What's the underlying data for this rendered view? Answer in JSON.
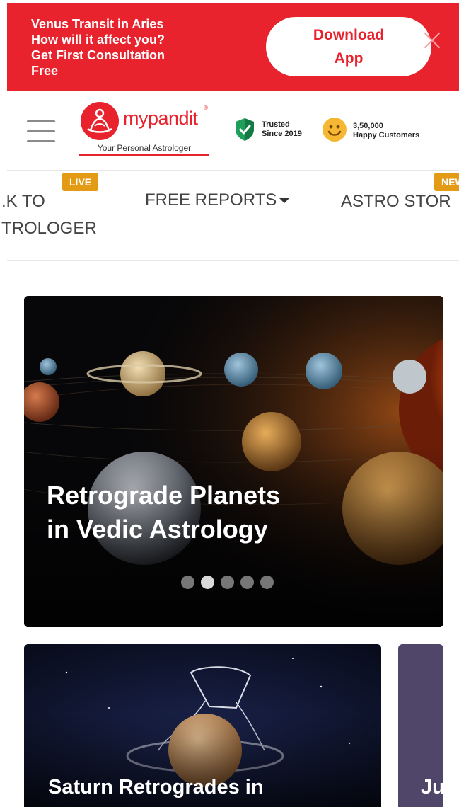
{
  "promo": {
    "lines": [
      "Venus Transit in Aries",
      "How will it affect you?",
      "Get First Consultation",
      "Free"
    ],
    "download_lines": [
      "Download",
      "App"
    ],
    "close_icon": "close-icon"
  },
  "header": {
    "menu_icon": "hamburger-icon",
    "logo_word": "mypandit",
    "logo_tm": "®",
    "logo_tagline": "Your Personal Astrologer",
    "trust_lines": [
      "Trusted",
      "Since 2019"
    ],
    "happy_lines": [
      "3,50,000",
      "Happy Customers"
    ]
  },
  "nav": {
    "items": [
      {
        "lines": [
          ".K TO",
          "TROLOGER"
        ],
        "badge": "LIVE"
      },
      {
        "label": "FREE REPORTS"
      },
      {
        "label": "ASTRO STOR",
        "badge": "NEW"
      }
    ]
  },
  "hero": {
    "title_lines": [
      "Retrograde Planets",
      "in Vedic Astrology"
    ],
    "slide_count": 5,
    "active_slide": 2
  },
  "cards": [
    {
      "title": "Saturn Retrogrades in"
    },
    {
      "title": "Ju"
    }
  ],
  "colors": {
    "brand_red": "#e8232e",
    "badge_orange": "#e39a14"
  }
}
